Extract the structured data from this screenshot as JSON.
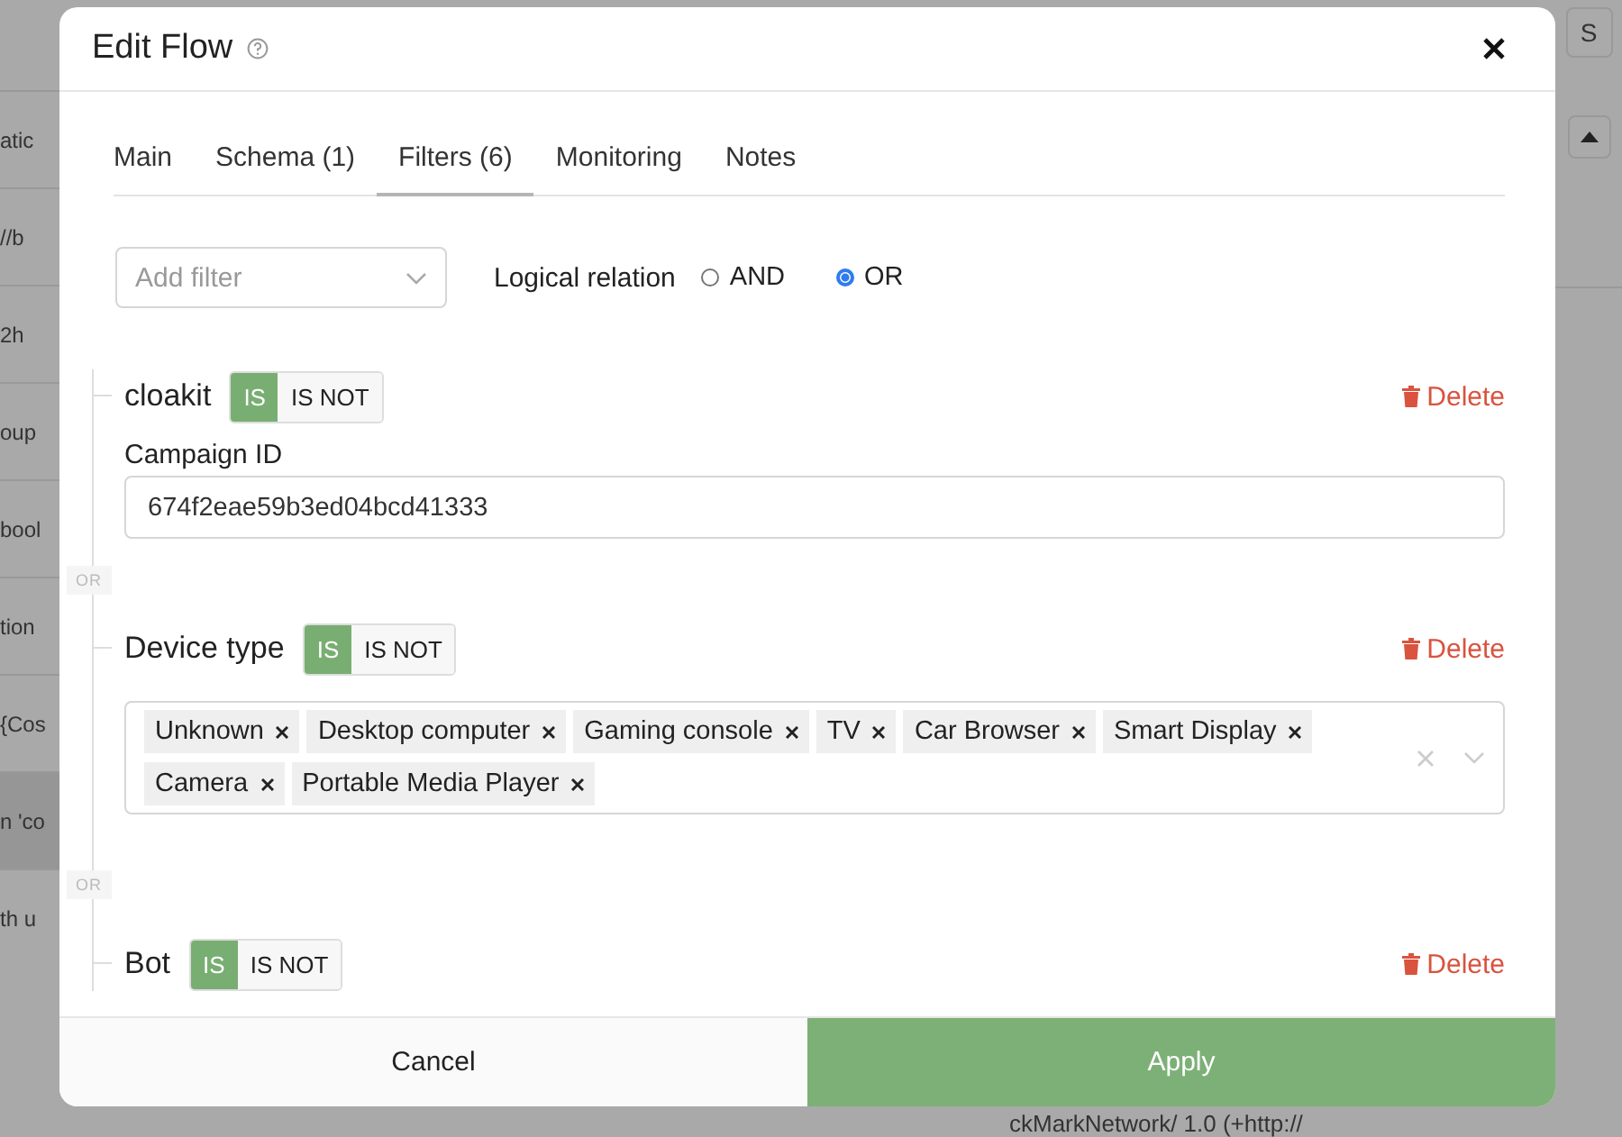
{
  "background": {
    "left_fragments": [
      "atic",
      "//b",
      "2h",
      "oup",
      "bool",
      "tion",
      "{Cos",
      "n 'co",
      "th u"
    ],
    "right_button": "S",
    "bottom_text": "ckMarkNetwork/ 1.0 (+http://"
  },
  "dialog": {
    "title": "Edit Flow",
    "tabs": [
      {
        "label": "Main",
        "selected": false
      },
      {
        "label": "Schema (1)",
        "selected": false
      },
      {
        "label": "Filters (6)",
        "selected": true
      },
      {
        "label": "Monitoring",
        "selected": false
      },
      {
        "label": "Notes",
        "selected": false
      }
    ],
    "add_filter": {
      "placeholder": "Add filter"
    },
    "logical_relation": {
      "label": "Logical relation",
      "options": [
        {
          "label": "AND",
          "selected": false
        },
        {
          "label": "OR",
          "selected": true
        }
      ]
    },
    "filters": [
      {
        "name": "cloakit",
        "kind": "text",
        "mode": [
          {
            "label": "IS",
            "selected": true
          },
          {
            "label": "IS NOT",
            "selected": false
          }
        ],
        "delete": "Delete",
        "field_label": "Campaign ID",
        "value": "674f2eae59b3ed04bcd41333"
      },
      {
        "name": "Device type",
        "kind": "tags",
        "joined_by": "OR",
        "mode": [
          {
            "label": "IS",
            "selected": true
          },
          {
            "label": "IS NOT",
            "selected": false
          }
        ],
        "delete": "Delete",
        "tags": [
          "Unknown",
          "Desktop computer",
          "Gaming console",
          "TV",
          "Car Browser",
          "Smart Display",
          "Camera",
          "Portable Media Player"
        ]
      },
      {
        "name": "Bot",
        "kind": "flag",
        "joined_by": "OR",
        "mode": [
          {
            "label": "IS",
            "selected": true
          },
          {
            "label": "IS NOT",
            "selected": false
          }
        ],
        "delete": "Delete"
      }
    ],
    "footer": {
      "cancel": "Cancel",
      "apply": "Apply"
    }
  }
}
